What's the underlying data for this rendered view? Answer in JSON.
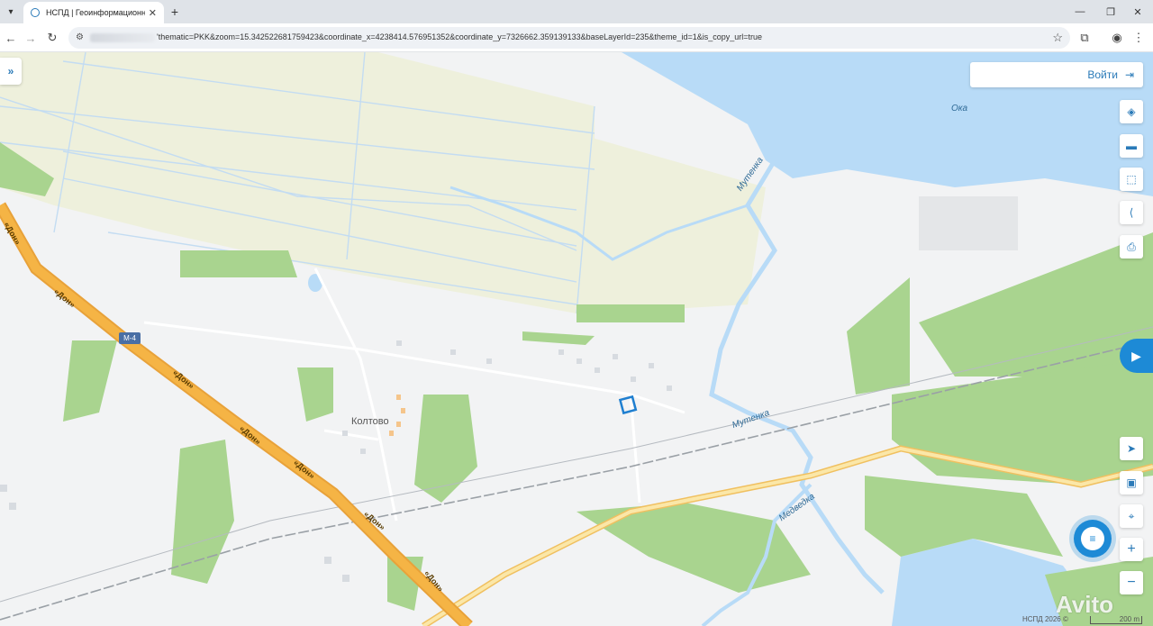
{
  "browser": {
    "tab_title": "НСПД | Геоинформационный",
    "tab_close": "✕",
    "new_tab": "+",
    "url": "'thematic=PKK&zoom=15.342522681759423&coordinate_x=4238414.576951352&coordinate_y=7326662.359139133&baseLayerId=235&theme_id=1&is_copy_url=true"
  },
  "map": {
    "login_label": "Войти",
    "water_labels": {
      "oka": "Ока",
      "mutenka_1": "Мутенка",
      "mutenka_2": "Мутенка",
      "medvedka": "Медведка"
    },
    "place_labels": {
      "koltovo": "Колтово"
    },
    "road_labels": [
      "«Дон»",
      "«Дон»",
      "«Дон»",
      "«Дон»",
      "«Дон»",
      "«Дон»",
      "«Дон»"
    ],
    "highway_badge": "М-4",
    "attribution": "НСПД 2026 ©",
    "scale_label": "200 m",
    "watermark": "Avito"
  },
  "toolbar": {
    "tools": [
      "layers-icon",
      "ruler-icon",
      "select-area-icon",
      "share-icon",
      "print-icon",
      "locate-icon",
      "minimap-icon",
      "geo-search-icon",
      "zoom-in-icon",
      "zoom-out-icon"
    ]
  },
  "colors": {
    "water": "#b8dbf7",
    "forest": "#a9d48f",
    "field": "#eef0dc",
    "road_major": "#f5b445",
    "road_minor": "#fbe7a8",
    "accent": "#2a7ab8",
    "parcel_outline": "#1f7fd0"
  }
}
